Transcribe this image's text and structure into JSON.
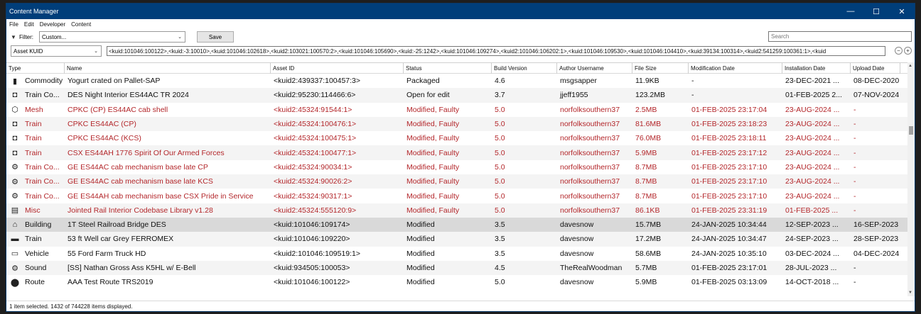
{
  "window": {
    "title": "Content Manager",
    "minimize": "—",
    "maximize": "☐",
    "close": "✕"
  },
  "menu": [
    "File",
    "Edit",
    "Developer",
    "Content"
  ],
  "filter": {
    "label": "Filter:",
    "value": "Custom...",
    "save": "Save",
    "search_placeholder": "Search"
  },
  "kuid": {
    "mode": "Asset KUID",
    "value": "<kuid:101046:100122>,<kuid:-3:10010>,<kuid:101046:102618>,<kuid2:103021:100570:2>,<kuid:101046:105690>,<kuid:-25:1242>,<kuid:101046:109274>,<kuid2:101046:106202:1>,<kuid:101046:109530>,<kuid:101046:104410>,<kuid:39134:100314>,<kuid2:541259:100361:1>,<kuid"
  },
  "columns": [
    "Type",
    "Name",
    "Asset ID",
    "Status",
    "Build Version",
    "Author Username",
    "File Size",
    "Modification Date",
    "Installation Date",
    "Upload Date"
  ],
  "rows": [
    {
      "icon": "commodity-icon",
      "glyph": "▮",
      "type": "Commodity",
      "name": "Yogurt crated on Pallet-SAP",
      "asset": "<kuid2:439337:100457:3>",
      "status": "Packaged",
      "build": "4.6",
      "author": "msgsapper",
      "size": "11.9KB",
      "mod": "-",
      "inst": "23-DEC-2021 ...",
      "up": "08-DEC-2020",
      "faulty": false,
      "selected": false
    },
    {
      "icon": "train-icon",
      "glyph": "◘",
      "type": "Train Co...",
      "name": "DES Night Interior ES44AC TR 2024",
      "asset": "<kuid2:95230:114466:6>",
      "status": "Open for edit",
      "build": "3.7",
      "author": "jjeff1955",
      "size": "123.2MB",
      "mod": "-",
      "inst": "01-FEB-2025 2...",
      "up": "07-NOV-2024",
      "faulty": false,
      "selected": false
    },
    {
      "icon": "mesh-icon",
      "glyph": "⬡",
      "type": "Mesh",
      "name": "CPKC (CP) ES44AC cab shell",
      "asset": "<kuid2:45324:91544:1>",
      "status": "Modified, Faulty",
      "build": "5.0",
      "author": "norfolksouthern37",
      "size": "2.5MB",
      "mod": "01-FEB-2025 23:17:04",
      "inst": "23-AUG-2024 ...",
      "up": "-",
      "faulty": true,
      "selected": false
    },
    {
      "icon": "train-icon",
      "glyph": "◘",
      "type": "Train",
      "name": "CPKC ES44AC (CP)",
      "asset": "<kuid2:45324:100476:1>",
      "status": "Modified, Faulty",
      "build": "5.0",
      "author": "norfolksouthern37",
      "size": "81.6MB",
      "mod": "01-FEB-2025 23:18:23",
      "inst": "23-AUG-2024 ...",
      "up": "-",
      "faulty": true,
      "selected": false
    },
    {
      "icon": "train-icon",
      "glyph": "◘",
      "type": "Train",
      "name": "CPKC ES44AC (KCS)",
      "asset": "<kuid2:45324:100475:1>",
      "status": "Modified, Faulty",
      "build": "5.0",
      "author": "norfolksouthern37",
      "size": "76.0MB",
      "mod": "01-FEB-2025 23:18:11",
      "inst": "23-AUG-2024 ...",
      "up": "-",
      "faulty": true,
      "selected": false
    },
    {
      "icon": "train-icon",
      "glyph": "◘",
      "type": "Train",
      "name": "CSX ES44AH 1776 Spirit Of Our Armed Forces",
      "asset": "<kuid2:45324:100477:1>",
      "status": "Modified, Faulty",
      "build": "5.0",
      "author": "norfolksouthern37",
      "size": "5.9MB",
      "mod": "01-FEB-2025 23:17:12",
      "inst": "23-AUG-2024 ...",
      "up": "-",
      "faulty": true,
      "selected": false
    },
    {
      "icon": "gear-icon",
      "glyph": "⚙",
      "type": "Train Co...",
      "name": "GE ES44AC cab mechanism base late CP",
      "asset": "<kuid2:45324:90034:1>",
      "status": "Modified, Faulty",
      "build": "5.0",
      "author": "norfolksouthern37",
      "size": "8.7MB",
      "mod": "01-FEB-2025 23:17:10",
      "inst": "23-AUG-2024 ...",
      "up": "-",
      "faulty": true,
      "selected": false
    },
    {
      "icon": "gear-icon",
      "glyph": "⚙",
      "type": "Train Co...",
      "name": "GE ES44AC cab mechanism base late KCS",
      "asset": "<kuid2:45324:90026:2>",
      "status": "Modified, Faulty",
      "build": "5.0",
      "author": "norfolksouthern37",
      "size": "8.7MB",
      "mod": "01-FEB-2025 23:17:10",
      "inst": "23-AUG-2024 ...",
      "up": "-",
      "faulty": true,
      "selected": false
    },
    {
      "icon": "gear-icon",
      "glyph": "⚙",
      "type": "Train Co...",
      "name": "GE ES44AH cab mechanism base CSX Pride in Service",
      "asset": "<kuid2:45324:90317:1>",
      "status": "Modified, Faulty",
      "build": "5.0",
      "author": "norfolksouthern37",
      "size": "8.7MB",
      "mod": "01-FEB-2025 23:17:10",
      "inst": "23-AUG-2024 ...",
      "up": "-",
      "faulty": true,
      "selected": false
    },
    {
      "icon": "library-icon",
      "glyph": "▤",
      "type": "Misc",
      "name": "Jointed Rail Interior Codebase Library v1.28",
      "asset": "<kuid2:45324:555120:9>",
      "status": "Modified, Faulty",
      "build": "5.0",
      "author": "norfolksouthern37",
      "size": "86.1KB",
      "mod": "01-FEB-2025 23:31:19",
      "inst": "01-FEB-2025 ...",
      "up": "-",
      "faulty": true,
      "selected": false
    },
    {
      "icon": "building-icon",
      "glyph": "⌂",
      "type": "Building",
      "name": "1T Steel Railroad Bridge DES",
      "asset": "<kuid:101046:109174>",
      "status": "Modified",
      "build": "3.5",
      "author": "davesnow",
      "size": "15.7MB",
      "mod": "24-JAN-2025 10:34:44",
      "inst": "12-SEP-2023 ...",
      "up": "16-SEP-2023",
      "faulty": false,
      "selected": true
    },
    {
      "icon": "railcar-icon",
      "glyph": "▬",
      "type": "Train",
      "name": "53 ft Well car Grey FERROMEX",
      "asset": "<kuid:101046:109220>",
      "status": "Modified",
      "build": "3.5",
      "author": "davesnow",
      "size": "17.2MB",
      "mod": "24-JAN-2025 10:34:47",
      "inst": "24-SEP-2023 ...",
      "up": "28-SEP-2023",
      "faulty": false,
      "selected": false
    },
    {
      "icon": "vehicle-icon",
      "glyph": "▭",
      "type": "Vehicle",
      "name": "55 Ford Farm Truck HD",
      "asset": "<kuid2:101046:109519:1>",
      "status": "Modified",
      "build": "3.5",
      "author": "davesnow",
      "size": "58.6MB",
      "mod": "24-JAN-2025 10:35:10",
      "inst": "03-DEC-2024 ...",
      "up": "04-DEC-2024",
      "faulty": false,
      "selected": false
    },
    {
      "icon": "gear-icon",
      "glyph": "⚙",
      "type": "Sound",
      "name": "[SS] Nathan Gross Ass K5HL w/ E-Bell",
      "asset": "<kuid:934505:100053>",
      "status": "Modified",
      "build": "4.5",
      "author": "TheRealWoodman",
      "size": "5.7MB",
      "mod": "01-FEB-2025 23:17:01",
      "inst": "28-JUL-2023 ...",
      "up": "-",
      "faulty": false,
      "selected": false
    },
    {
      "icon": "map-pin-icon",
      "glyph": "⬤",
      "type": "Route",
      "name": "AAA Test Route TRS2019",
      "asset": "<kuid:101046:100122>",
      "status": "Modified",
      "build": "5.0",
      "author": "davesnow",
      "size": "5.9MB",
      "mod": "01-FEB-2025 03:13:09",
      "inst": "14-OCT-2018 ...",
      "up": "-",
      "faulty": false,
      "selected": false
    }
  ],
  "status_bar": "1 item selected. 1432 of 744228 items displayed."
}
